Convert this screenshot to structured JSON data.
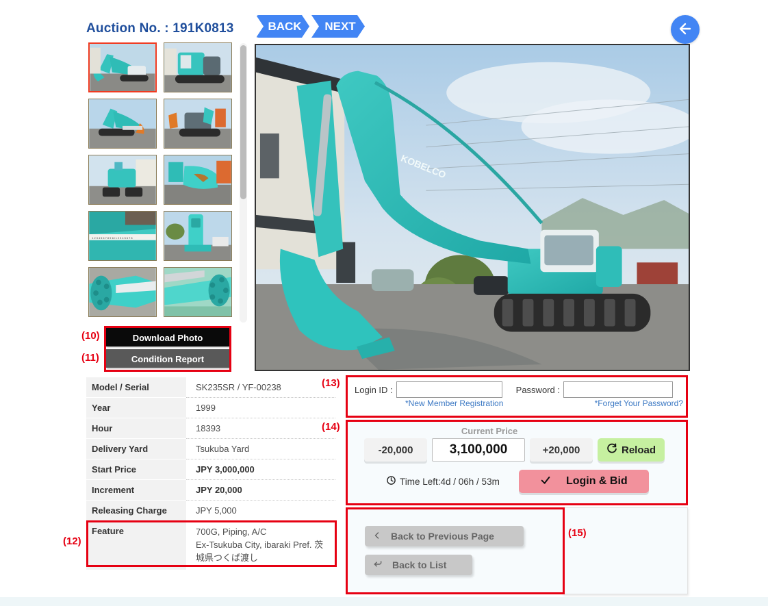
{
  "header": {
    "auction_no": "Auction No. : 191K0813",
    "back_label": "BACK",
    "next_label": "NEXT",
    "circle_back_icon": "arrow-left-icon"
  },
  "gallery": {
    "thumb_count": 10,
    "selected_index": 0,
    "thumbnails": [
      {
        "alt": "excavator-side-view-boom-extended"
      },
      {
        "alt": "excavator-rear-cab-view"
      },
      {
        "alt": "excavator-left-side-full"
      },
      {
        "alt": "excavator-rear-quarter-view"
      },
      {
        "alt": "excavator-front-undercarriage"
      },
      {
        "alt": "excavator-bucket-closeup"
      },
      {
        "alt": "boom-measurement-tape"
      },
      {
        "alt": "arm-cylinder-closeup"
      },
      {
        "alt": "hydraulic-cylinder-rod"
      },
      {
        "alt": "hydraulic-cylinder-rod-angle"
      }
    ]
  },
  "buttons": {
    "download_photo": "Download Photo",
    "condition_report": "Condition Report"
  },
  "spec": {
    "rows": [
      {
        "key": "Model / Serial",
        "value": "SK235SR / YF-00238",
        "bold": false
      },
      {
        "key": "Year",
        "value": "1999",
        "bold": false
      },
      {
        "key": "Hour",
        "value": "18393",
        "bold": false
      },
      {
        "key": "Delivery Yard",
        "value": "Tsukuba Yard",
        "bold": false
      },
      {
        "key": "Start Price",
        "value": "JPY 3,000,000",
        "bold": true
      },
      {
        "key": "Increment",
        "value": "JPY 20,000",
        "bold": true
      },
      {
        "key": "Releasing Charge",
        "value": "JPY 5,000",
        "bold": false
      }
    ],
    "feature_key": "Feature",
    "feature_lines": [
      "700G, Piping, A/C",
      "Ex-Tsukuba City, ibaraki Pref. 茨",
      "城県つくば渡し"
    ]
  },
  "login": {
    "id_label": "Login ID :",
    "id_value": "",
    "id_placeholder": "",
    "password_label": "Password :",
    "password_value": "",
    "password_placeholder": "",
    "new_member_link": "*New Member Registration",
    "forgot_link": "*Forget Your Password?"
  },
  "price": {
    "current_price_label": "Current Price",
    "decrement_label": "-20,000",
    "current_price_value": "3,100,000",
    "increment_label": "+20,000",
    "reload_label": "Reload",
    "reload_icon": "refresh-icon",
    "time_left": "Time Left:4d / 06h / 53m",
    "clock_icon": "clock-icon",
    "bid_label": "Login & Bid",
    "bid_icon": "check-icon"
  },
  "nav": {
    "back_previous": "Back to Previous Page",
    "back_previous_icon": "chevron-left-icon",
    "back_to_list": "Back to List",
    "back_to_list_icon": "return-arrow-icon"
  },
  "annotations": {
    "a10": "(10)",
    "a11": "(11)",
    "a12": "(12)",
    "a13": "(13)",
    "a14": "(14)",
    "a15": "(15)"
  },
  "colors": {
    "accent_blue": "#4285f4",
    "title_blue": "#1f4e9c",
    "annotation_red": "#e60012",
    "reload_green": "#c6f0a0",
    "bid_pink": "#f2919c",
    "link_blue": "#3b78c3"
  }
}
